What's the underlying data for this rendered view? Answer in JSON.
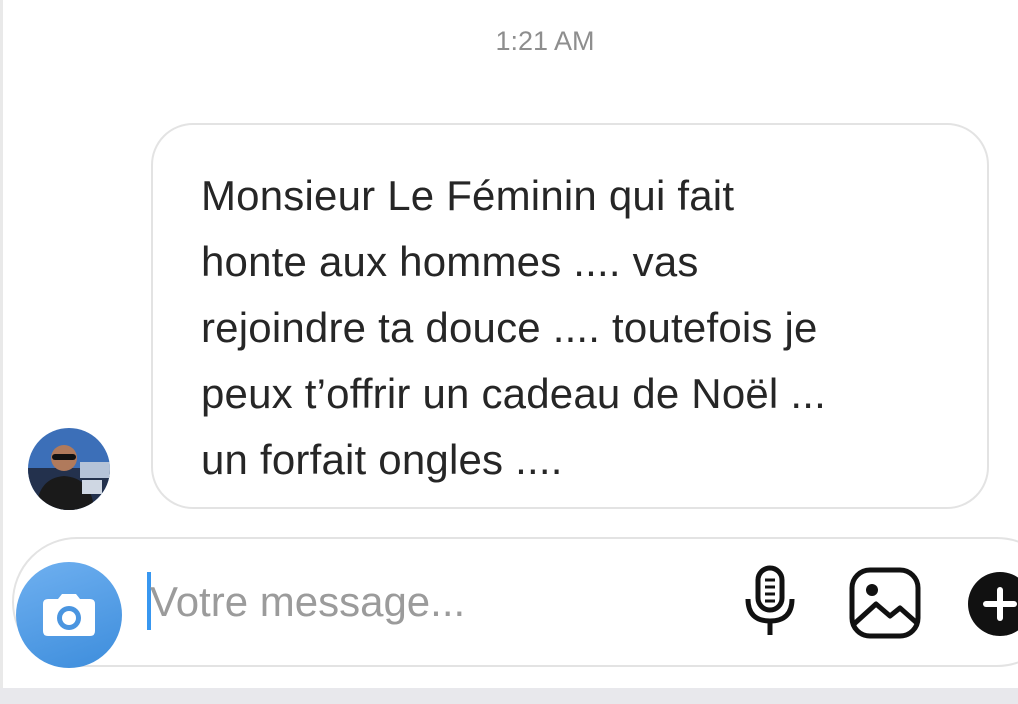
{
  "thread": {
    "timestamp": "1:21 AM"
  },
  "message": {
    "sender_avatar": "avatar-photo",
    "text": "Monsieur Le Féminin qui fait\nhonte aux hommes .... vas\nrejoindre ta douce .... toutefois je\npeux t’offrir un cadeau de Noël ...\nun forfait ongles ...."
  },
  "composer": {
    "placeholder": "Votre message...",
    "value": "",
    "camera_icon": "camera-icon",
    "mic_icon": "microphone-icon",
    "gallery_icon": "image-icon",
    "plus_icon": "plus-icon"
  },
  "colors": {
    "camera_button": "#3d8ddc",
    "caret": "#3897f0",
    "text": "#262626",
    "muted": "#8e8e8e"
  }
}
